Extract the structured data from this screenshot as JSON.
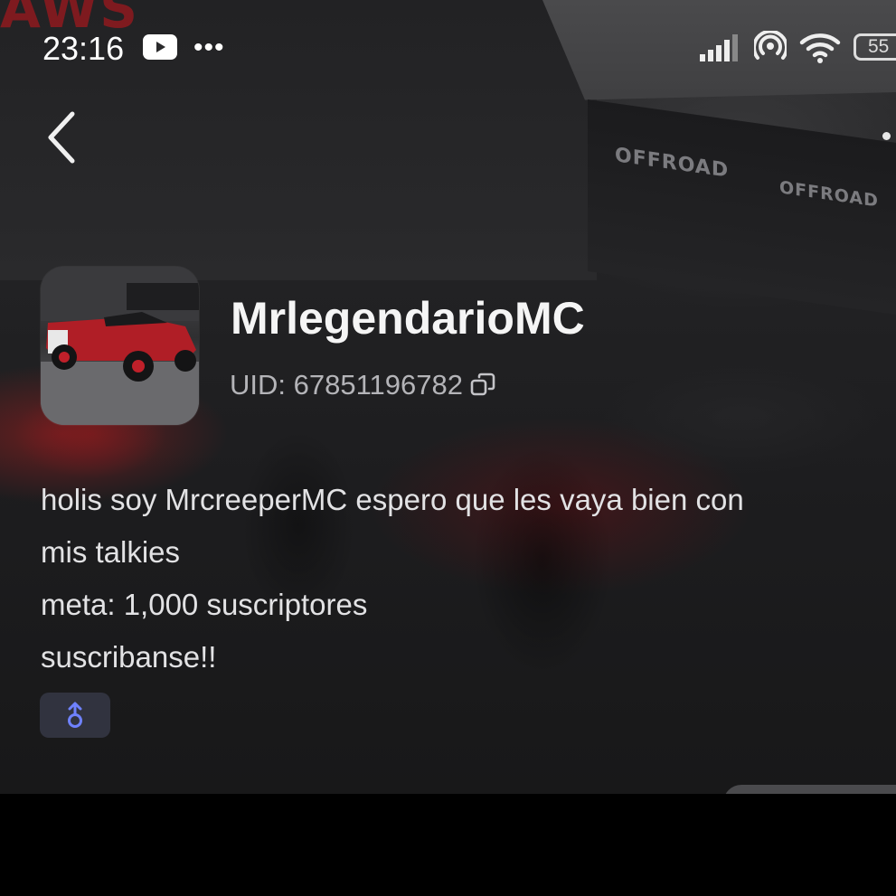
{
  "status_bar": {
    "time": "23:16",
    "icons": [
      "youtube-icon",
      "more-dots-icon",
      "signal-icon",
      "hotspot-icon",
      "wifi-icon",
      "battery-icon"
    ],
    "battery_level": "55"
  },
  "background": {
    "logo_fragment": "AWS",
    "sign_1": "OFFROAD",
    "sign_2": "OFFROAD"
  },
  "profile": {
    "username": "MrlegendarioMC",
    "uid_label": "UID: 67851196782",
    "bio_lines": [
      "holis soy MrcreeperMC espero que les vaya bien con",
      "mis talkies",
      "meta: 1,000 suscriptores",
      "suscribanse!!"
    ],
    "badge_icon": "gender-male-icon",
    "accent_color": "#6f82ff"
  }
}
